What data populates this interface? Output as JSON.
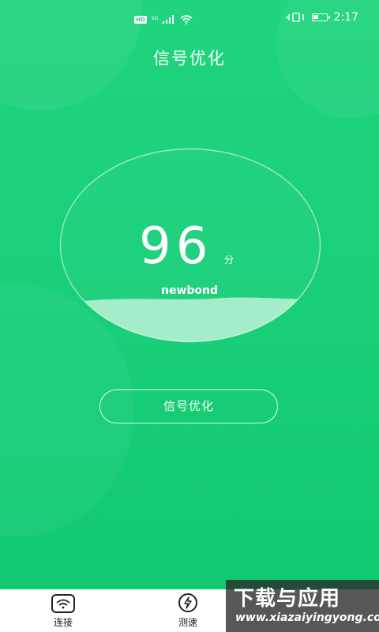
{
  "status_bar": {
    "left_badge": "HD",
    "network_type": "5G",
    "time": "2:17",
    "icons": [
      "hd-badge-icon",
      "signal-icon",
      "wifi-icon",
      "vibrate-icon",
      "battery-icon"
    ]
  },
  "header": {
    "title": "信号优化"
  },
  "score": {
    "value": "96",
    "unit": "分",
    "network_name": "newbond",
    "fill_level": 0.22
  },
  "actions": {
    "optimize_label": "信号优化"
  },
  "bottom_nav": {
    "items": [
      {
        "label": "连接",
        "icon": "wifi-icon"
      },
      {
        "label": "测速",
        "icon": "bolt-icon"
      }
    ]
  },
  "watermark": {
    "title": "下载与应用",
    "url": "www.xiazaiyingyong.com"
  },
  "colors": {
    "primary_green": "#1dd37a",
    "white": "#ffffff",
    "nav_text": "#222222"
  }
}
